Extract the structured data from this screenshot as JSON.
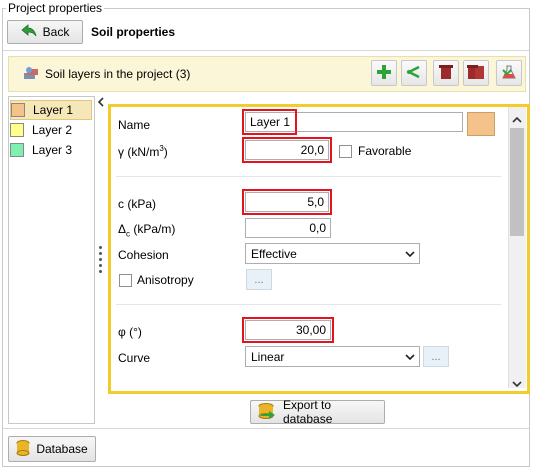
{
  "window": {
    "group_title": "Project properties"
  },
  "header": {
    "back_label": "Back",
    "title": "Soil properties"
  },
  "toolbar": {
    "label": "Soil layers in the project (3)",
    "buttons": [
      "add-icon",
      "share-icon",
      "delete-icon",
      "delete-all-icon",
      "import-icon"
    ]
  },
  "layers": [
    {
      "name": "Layer 1",
      "color": "#f5c38a",
      "selected": true
    },
    {
      "name": "Layer 2",
      "color": "#ffff8c",
      "selected": false
    },
    {
      "name": "Layer 3",
      "color": "#7ff0b0",
      "selected": false
    }
  ],
  "form": {
    "name_label": "Name",
    "name_value": "Layer 1",
    "name_color": "#f5c38a",
    "gamma_label_main": "γ (kN/m",
    "gamma_label_sup": "3",
    "gamma_label_end": ")",
    "gamma_value": "20,0",
    "favorable_label": "Favorable",
    "c_label": "c (kPa)",
    "c_value": "5,0",
    "dc_label_main": "Δ",
    "dc_label_sub": "c",
    "dc_label_end": " (kPa/m)",
    "dc_value": "0,0",
    "cohesion_label": "Cohesion",
    "cohesion_value": "Effective",
    "anisotropy_label": "Anisotropy",
    "ellipsis": "...",
    "phi_label": "φ (°)",
    "phi_value": "30,00",
    "curve_label": "Curve",
    "curve_value": "Linear"
  },
  "footer": {
    "export_label": "Export to database",
    "database_label": "Database"
  },
  "colors": {
    "highlight_border": "#f2cc2b",
    "emphasis_box": "#e3141e",
    "toolbar_bg": "#fcf6d8"
  }
}
